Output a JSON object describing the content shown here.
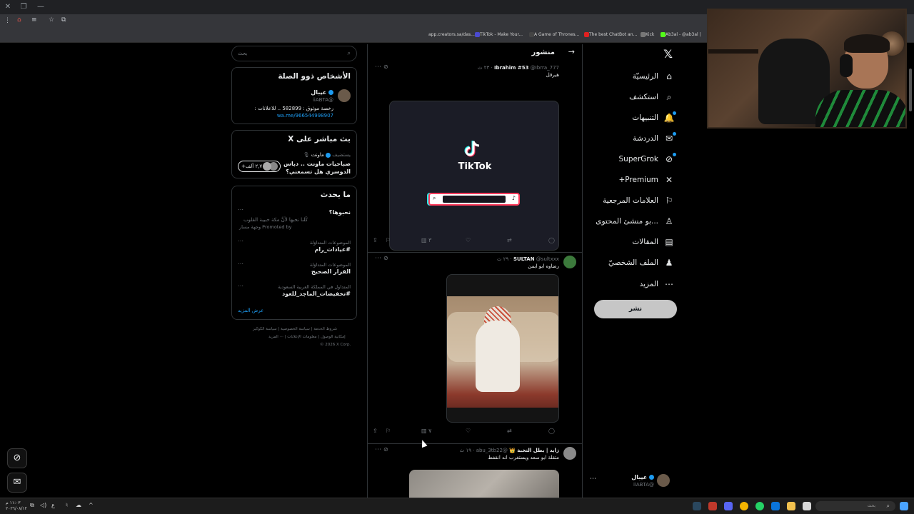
{
  "browser": {
    "bookmarks": [
      {
        "label": "app.creators.sa/das...",
        "color": "#6b6b6b"
      },
      {
        "label": "TikTok - Make Your...",
        "color": "#4a4ad0"
      },
      {
        "label": "A Game of Thrones...",
        "color": "#222222"
      },
      {
        "label": "The best ChatBot an...",
        "color": "#e02020"
      },
      {
        "label": "Kick",
        "color": "#53fc18"
      },
      {
        "label": "Ab3al - @ab3al |",
        "color": "#53fc18"
      }
    ]
  },
  "nav": {
    "items": [
      {
        "label": "الرئيسيّة",
        "icon": "home-icon",
        "glyph": "⌂",
        "dot": false
      },
      {
        "label": "استكشف",
        "icon": "search-icon",
        "glyph": "⌕",
        "dot": false
      },
      {
        "label": "التنبيهات",
        "icon": "bell-icon",
        "glyph": "🔔",
        "dot": true
      },
      {
        "label": "الدردشة",
        "icon": "mail-icon",
        "glyph": "✉",
        "dot": true
      },
      {
        "label": "SuperGrok",
        "icon": "grok-icon",
        "glyph": "⊘",
        "dot": true
      },
      {
        "label": "Premium+",
        "icon": "x-icon",
        "glyph": "✕",
        "dot": false
      },
      {
        "label": "العلامات المرجعية",
        "icon": "bookmark-icon",
        "glyph": "⚐",
        "dot": false
      },
      {
        "label": "...بو منشئ المحتوى",
        "icon": "creator-icon",
        "glyph": "♙",
        "dot": false
      },
      {
        "label": "المقالات",
        "icon": "articles-icon",
        "glyph": "▤",
        "dot": false
      },
      {
        "label": "الملف الشخصيّ",
        "icon": "profile-icon",
        "glyph": "♟",
        "dot": false
      },
      {
        "label": "المزيد",
        "icon": "more-icon",
        "glyph": "⋯",
        "dot": false
      }
    ],
    "post_label": "نشر",
    "account": {
      "name": "عيبال",
      "handle": "@iiABTA"
    }
  },
  "feed": {
    "title": "منشور",
    "tweets": [
      {
        "name": "Ibrahim #53",
        "handle": "@Ibrra_777",
        "time": "٢٣ ث",
        "text": "هيرقل",
        "media": "TikTok",
        "views": "٣"
      },
      {
        "name": "SULTAN",
        "handle": "@sultxxx",
        "time": "٢٩ ث",
        "text": "رضاوه ابو ايمن",
        "views": "٧"
      },
      {
        "name": "زايد | بطل النخبة 👑",
        "handle": "@abu_3tb22",
        "time": "١٩ ث",
        "text": "متقلة ابو سعد ويستغرب انه انقفط"
      }
    ]
  },
  "sidebar": {
    "search_placeholder": "بحث",
    "related": {
      "title": "الأشخاص ذوو الصلة",
      "name": "عيبال",
      "handle": "@iiABTA",
      "bio": "رخصة موثوق : 582899 .. للاعلانات :",
      "link": "wa.me/966544998907"
    },
    "live": {
      "title": "بث مباشر على X",
      "host_prefix": "يستضيف",
      "host": "ماونت",
      "text_line1": "صباحيات ماونت .. دباس",
      "text_line2": "الدوسري هل تسمعني؟",
      "listeners": "+٢,٧ ألف"
    },
    "trends": {
      "title": "ما يحدث",
      "items": [
        {
          "context": "",
          "topic": "نحبوها؟",
          "sub": "كُلنا نحبها لأنَّ مكة حبيبة القلوب",
          "promoted": "Promoted by وجهة مسار"
        },
        {
          "context": "الموضوعات المتداوَلة",
          "topic": "#عيادات_رام",
          "sub": "",
          "promoted": ""
        },
        {
          "context": "الموضوعات المتداوَلة",
          "topic": "القرار الصحيح",
          "sub": "",
          "promoted": ""
        },
        {
          "context": "المتداول في المملكة العربية السعودية",
          "topic": "#تخفيضات_الماجد_للعود",
          "sub": "",
          "promoted": ""
        }
      ],
      "show_more": "عرض المزيد"
    },
    "footer": {
      "row1": [
        "شروط الخدمة",
        "سياسة الخصوصية",
        "سياسة الكوكيز"
      ],
      "row2": [
        "إمكانية الوصول",
        "معلومات الإعلانات",
        "··· المزيد"
      ],
      "copyright": "© 2026 X Corp."
    }
  },
  "taskbar": {
    "time": "١١:٠٣ م",
    "date": "٢٠٢٦/٠٨/١٢",
    "search_placeholder": "بحث",
    "lang": "ع"
  }
}
